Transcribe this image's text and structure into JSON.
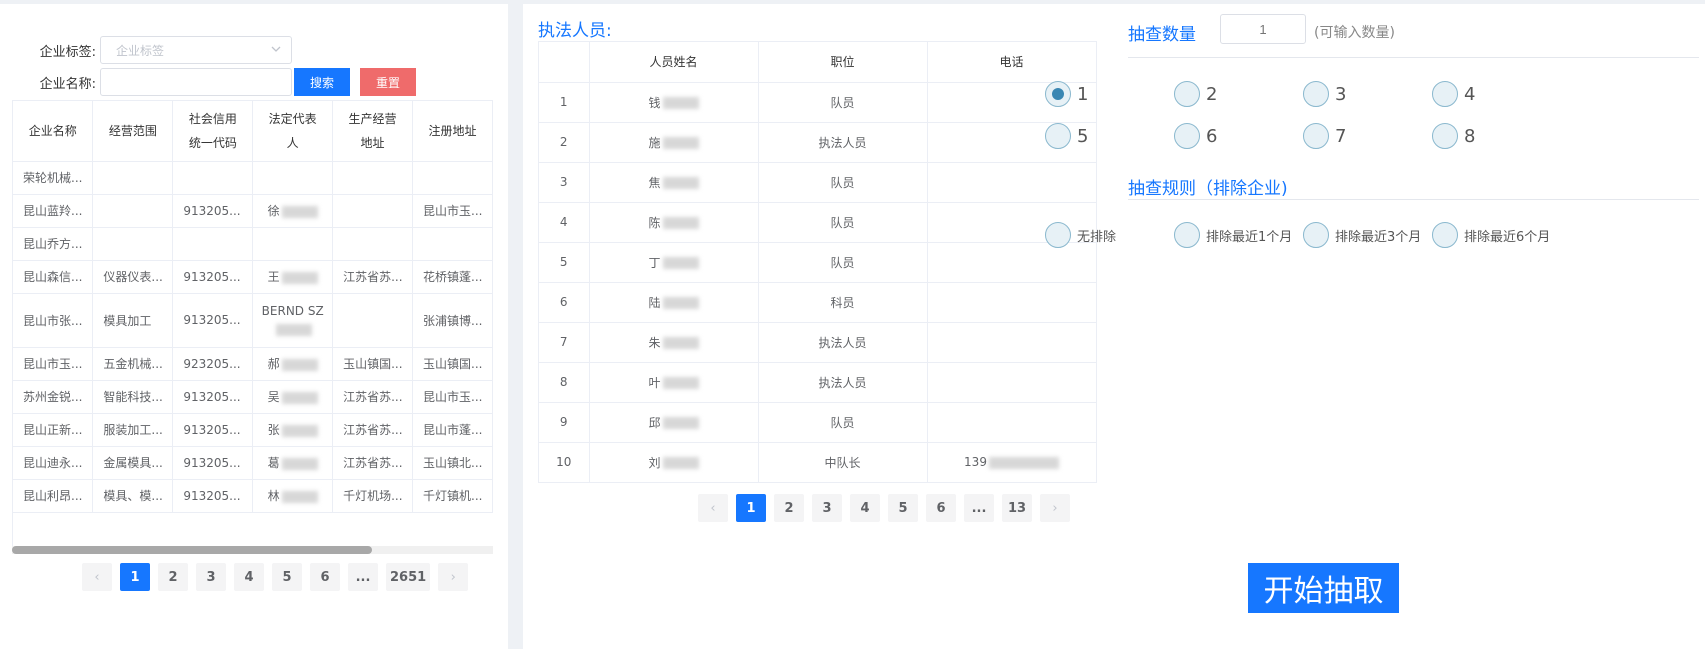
{
  "filter": {
    "tag_label": "企业标签:",
    "tag_placeholder": "企业标签",
    "name_label": "企业名称:",
    "name_value": "",
    "search_label": "搜索",
    "reset_label": "重置"
  },
  "company_table": {
    "headers": [
      "企业名称",
      "经营范围",
      "社会信用统一代码",
      "法定代表人",
      "生产经营地址",
      "注册地址"
    ],
    "rows": [
      [
        "荣轮机械...",
        "",
        "",
        "",
        "",
        ""
      ],
      [
        "昆山蓝羚...",
        "",
        "913205...",
        "徐",
        "",
        "昆山市玉..."
      ],
      [
        "昆山乔方...",
        "",
        "",
        "",
        "",
        ""
      ],
      [
        "昆山森信...",
        "仪器仪表...",
        "913205...",
        "王",
        "江苏省苏...",
        "花桥镇蓬..."
      ],
      [
        "昆山市张...",
        "模具加工",
        "913205...",
        "BERND SZ",
        "",
        "张浦镇博..."
      ],
      [
        "昆山市玉...",
        "五金机械...",
        "923205...",
        "郝",
        "玉山镇国...",
        "玉山镇国..."
      ],
      [
        "苏州金锐...",
        "智能科技...",
        "913205...",
        "吴",
        "江苏省苏...",
        "昆山市玉..."
      ],
      [
        "昆山正新...",
        "服装加工...",
        "913205...",
        "张",
        "江苏省苏...",
        "昆山市蓬..."
      ],
      [
        "昆山迪永...",
        "金属模具...",
        "913205...",
        "葛",
        "江苏省苏...",
        "玉山镇北..."
      ],
      [
        "昆山利昂...",
        "模具、模...",
        "913205...",
        "林",
        "千灯机场...",
        "千灯镇机..."
      ]
    ],
    "pagination": [
      "1",
      "2",
      "3",
      "4",
      "5",
      "6",
      "...",
      "2651"
    ],
    "current_page": "1"
  },
  "staff": {
    "title": "执法人员:",
    "headers": [
      "",
      "人员姓名",
      "职位",
      "电话"
    ],
    "rows": [
      [
        "1",
        "钱",
        "队员",
        ""
      ],
      [
        "2",
        "施",
        "执法人员",
        ""
      ],
      [
        "3",
        "焦",
        "队员",
        ""
      ],
      [
        "4",
        "陈",
        "队员",
        ""
      ],
      [
        "5",
        "丁",
        "队员",
        ""
      ],
      [
        "6",
        "陆",
        "科员",
        ""
      ],
      [
        "7",
        "朱",
        "执法人员",
        ""
      ],
      [
        "8",
        "叶",
        "执法人员",
        ""
      ],
      [
        "9",
        "邱",
        "队员",
        ""
      ],
      [
        "10",
        "刘",
        "中队长",
        "139"
      ]
    ],
    "pagination": [
      "1",
      "2",
      "3",
      "4",
      "5",
      "6",
      "...",
      "13"
    ],
    "current_page": "1"
  },
  "sampling": {
    "count_title": "抽查数量",
    "count_placeholder": "1",
    "count_hint": "(可输入数量)",
    "count_options": [
      "1",
      "2",
      "3",
      "4",
      "5",
      "6",
      "7",
      "8"
    ],
    "count_selected": "1",
    "rule_title": "抽查规则（排除企业)",
    "rule_options": [
      "无排除",
      "排除最近1个月",
      "排除最近3个月",
      "排除最近6个月"
    ],
    "rule_selected": "",
    "start_label": "开始抽取"
  },
  "colors": {
    "primary": "#1677ff",
    "danger": "#ef6b6b",
    "radio_checked": "#3a87b3"
  }
}
